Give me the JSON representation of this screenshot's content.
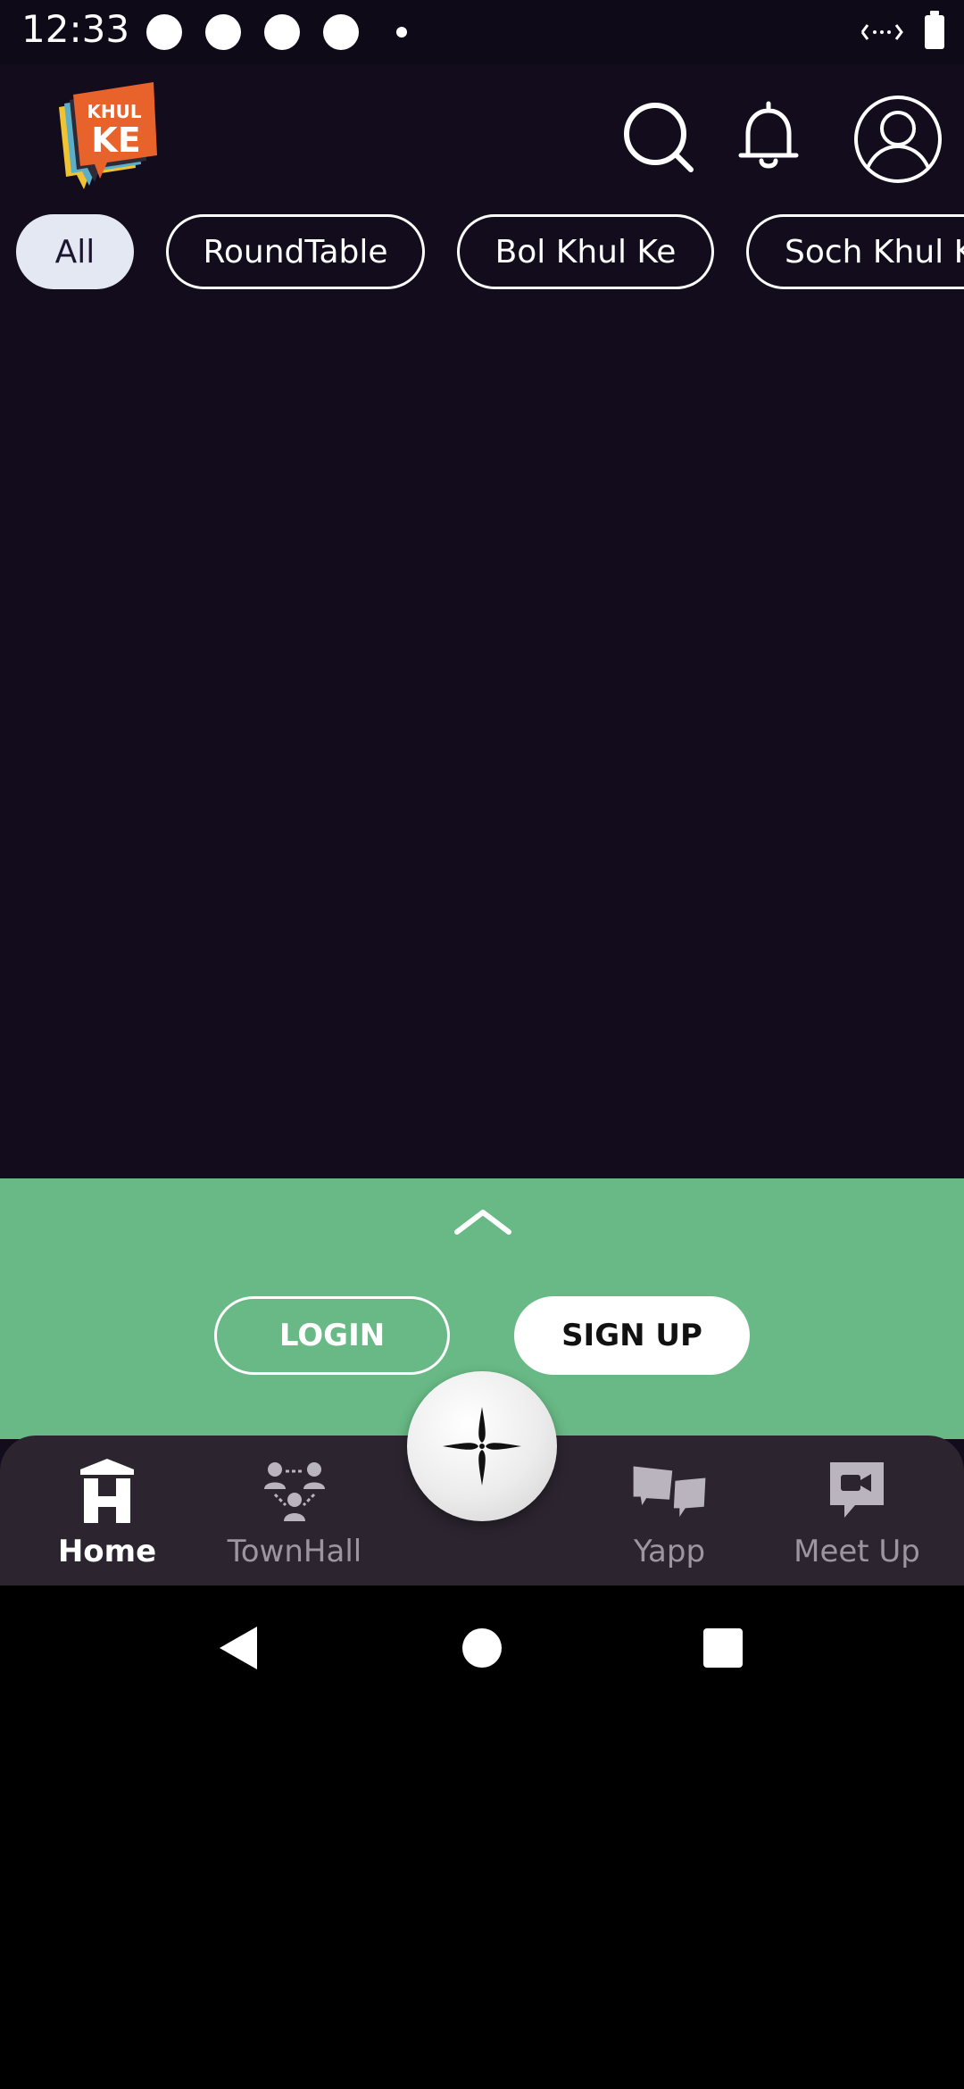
{
  "status_bar": {
    "time": "12:33"
  },
  "header": {
    "logo_text_top": "KHUL",
    "logo_text_bottom": "KE",
    "icons": [
      "search-icon",
      "bell-icon",
      "profile-icon"
    ]
  },
  "filters": {
    "chips": [
      {
        "label": "All",
        "active": true
      },
      {
        "label": "RoundTable",
        "active": false
      },
      {
        "label": "Bol Khul Ke",
        "active": false
      },
      {
        "label": "Soch Khul Ke",
        "active": false
      }
    ]
  },
  "auth_panel": {
    "login_label": "LOGIN",
    "signup_label": "SIGN UP",
    "background": "#68b985"
  },
  "bottom_nav": {
    "items": [
      {
        "label": "Home",
        "icon": "home-icon",
        "active": true
      },
      {
        "label": "TownHall",
        "icon": "townhall-icon",
        "active": false
      },
      {
        "label": "Yapp",
        "icon": "yapp-icon",
        "active": false
      },
      {
        "label": "Meet Up",
        "icon": "meetup-icon",
        "active": false
      }
    ],
    "center_button_icon": "sparkle-icon"
  },
  "colors": {
    "background": "#120c1c",
    "nav_background": "#2c2530",
    "logo_orange": "#e8622c"
  }
}
